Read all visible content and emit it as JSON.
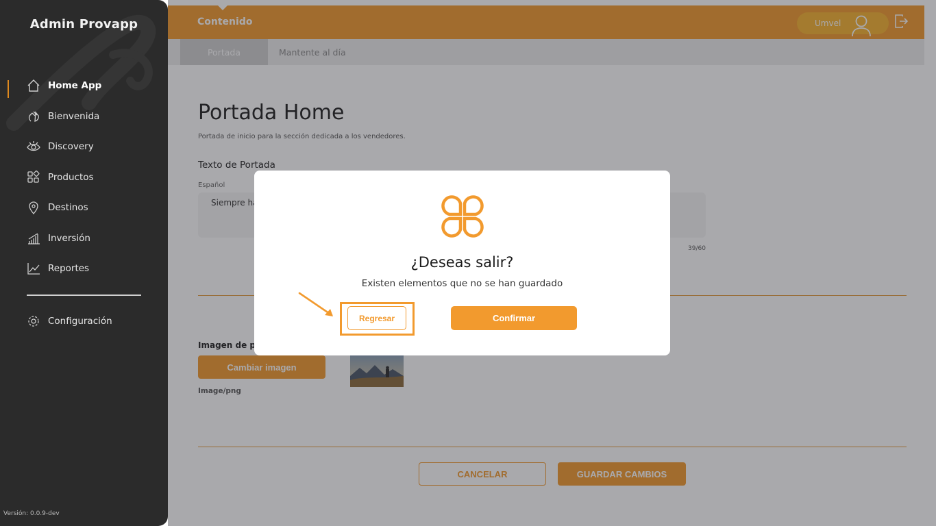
{
  "sidebar": {
    "brand": "Admin Provapp",
    "items": [
      {
        "label": "Home App",
        "icon": "home-icon",
        "active": true
      },
      {
        "label": "Bienvenida",
        "icon": "wave-hand-icon"
      },
      {
        "label": "Discovery",
        "icon": "eye-icon"
      },
      {
        "label": "Productos",
        "icon": "grid-icon"
      },
      {
        "label": "Destinos",
        "icon": "location-pin-icon"
      },
      {
        "label": "Inversión",
        "icon": "bar-chart-icon"
      },
      {
        "label": "Reportes",
        "icon": "line-chart-icon"
      }
    ],
    "settings_label": "Configuración",
    "version": "Versión: 0.0.9-dev"
  },
  "topbar": {
    "title": "Contenido",
    "user_name": "Umvel"
  },
  "tabs": [
    {
      "label": "Portada",
      "active": true
    },
    {
      "label": "Mantente al día",
      "active": false
    }
  ],
  "page": {
    "title": "Portada Home",
    "subtitle": "Portada de inicio para la sección dedicada a los vendedores.",
    "section_title": "Texto de Portada",
    "field_label": "Español",
    "field_value": "Siempre hay",
    "counter": "39/60",
    "image_label": "Imagen de po",
    "change_image": "Cambiar imagen",
    "image_format": "Image/png",
    "cancel": "CANCELAR",
    "save": "GUARDAR CAMBIOS"
  },
  "modal": {
    "title": "¿Deseas salir?",
    "message": "Existen elementos que no se han guardado",
    "back": "Regresar",
    "confirm": "Confirmar"
  },
  "colors": {
    "accent": "#f29a2e",
    "sidebar": "#2b2b2b",
    "user_pill": "#f7b32f"
  }
}
